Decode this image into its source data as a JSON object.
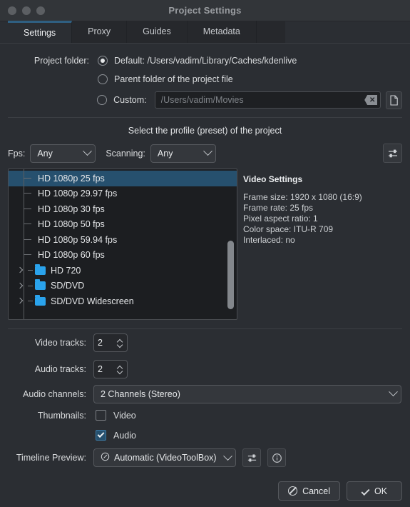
{
  "window": {
    "title": "Project Settings",
    "traffic_lights": [
      "close-button",
      "minimize-button",
      "maximize-button"
    ]
  },
  "tabs": [
    {
      "label": "Settings",
      "active": true
    },
    {
      "label": "Proxy",
      "active": false
    },
    {
      "label": "Guides",
      "active": false
    },
    {
      "label": "Metadata",
      "active": false
    }
  ],
  "project_folder": {
    "label": "Project folder:",
    "options": [
      {
        "label": "Default: /Users/vadim/Library/Caches/kdenlive",
        "selected": true
      },
      {
        "label": "Parent folder of the project file",
        "selected": false
      },
      {
        "label": "Custom:",
        "selected": false
      }
    ],
    "custom_placeholder": "/Users/vadim/Movies",
    "custom_value": "",
    "clear_icon": "clear-icon",
    "browse_icon": "file-browse-icon"
  },
  "profile": {
    "heading": "Select the profile (preset) of the project",
    "fps_label": "Fps:",
    "fps_value": "Any",
    "scanning_label": "Scanning:",
    "scanning_value": "Any",
    "manage_icon": "sliders-icon",
    "tree": [
      {
        "label": "HD 1080p 25 fps",
        "type": "leaf",
        "selected": true
      },
      {
        "label": "HD 1080p 29.97 fps",
        "type": "leaf",
        "selected": false
      },
      {
        "label": "HD 1080p 30 fps",
        "type": "leaf",
        "selected": false
      },
      {
        "label": "HD 1080p 50 fps",
        "type": "leaf",
        "selected": false
      },
      {
        "label": "HD 1080p 59.94 fps",
        "type": "leaf",
        "selected": false
      },
      {
        "label": "HD 1080p 60 fps",
        "type": "leaf",
        "selected": false
      },
      {
        "label": "HD 720",
        "type": "folder",
        "selected": false
      },
      {
        "label": "SD/DVD",
        "type": "folder",
        "selected": false
      },
      {
        "label": "SD/DVD Widescreen",
        "type": "folder",
        "selected": false
      }
    ]
  },
  "video_settings": {
    "heading": "Video Settings",
    "frame_size": "Frame size: 1920 x 1080 (16:9)",
    "frame_rate": "Frame rate: 25 fps",
    "pixel_aspect_ratio": "Pixel aspect ratio: 1",
    "color_space": "Color space: ITU-R 709",
    "interlaced": "Interlaced: no"
  },
  "tracks": {
    "video_label": "Video tracks:",
    "video_value": "2",
    "audio_label": "Audio tracks:",
    "audio_value": "2",
    "channels_label": "Audio channels:",
    "channels_value": "2 Channels (Stereo)"
  },
  "thumbnails": {
    "label": "Thumbnails:",
    "video_label": "Video",
    "video_checked": false,
    "audio_label": "Audio",
    "audio_checked": true
  },
  "timeline_preview": {
    "label": "Timeline Preview:",
    "value": "Automatic (VideoToolBox)",
    "value_icon": "clock-icon",
    "configure_icon": "sliders-icon",
    "info_icon": "info-icon"
  },
  "buttons": {
    "cancel": "Cancel",
    "ok": "OK"
  },
  "colors": {
    "background": "#2b2e33",
    "accent_selection": "#26506e",
    "tab_active_border": "#2f5f82",
    "folder_icon": "#2aa3ec"
  }
}
